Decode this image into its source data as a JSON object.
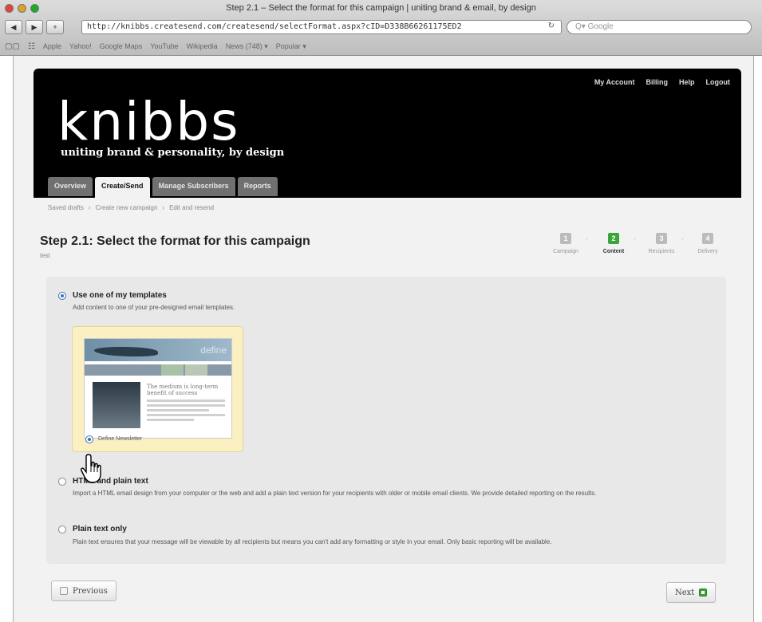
{
  "browser": {
    "window_title": "Step 2.1 – Select the format for this campaign | uniting brand & email, by design",
    "url": "http://knibbs.createsend.com/createsend/selectFormat.aspx?cID=D338B66261175ED2",
    "search_placeholder": "Q▾ Google",
    "bookmarks": [
      "Apple",
      "Yahoo!",
      "Google Maps",
      "YouTube",
      "Wikipedia",
      "News (748) ▾",
      "Popular ▾"
    ]
  },
  "header": {
    "logo": "knibbs",
    "tagline": "uniting brand & personality, by design",
    "account_links": [
      "My Account",
      "Billing",
      "Help",
      "Logout"
    ],
    "tabs": [
      "Overview",
      "Create/Send",
      "Manage Subscribers",
      "Reports"
    ],
    "active_tab_index": 1
  },
  "breadcrumb": [
    "Saved drafts",
    "›",
    "Create new campaign",
    "›",
    "Edit and resend"
  ],
  "step": {
    "title": "Step 2.1: Select the format for this campaign",
    "subtitle": "test",
    "progress": [
      {
        "num": "1",
        "label": "Campaign"
      },
      {
        "num": "2",
        "label": "Content"
      },
      {
        "num": "3",
        "label": "Recipients"
      },
      {
        "num": "4",
        "label": "Delivery"
      }
    ],
    "current_step_index": 1
  },
  "options": {
    "templates": {
      "title": "Use one of my templates",
      "desc": "Add content to one of your pre-designed email templates.",
      "template_label": "Define Newsletter",
      "thumb_word": "define",
      "thumb_heading": "The medium is long-term benefit of success"
    },
    "html": {
      "title": "HTML and plain text",
      "desc": "Import a HTML email design from your computer or the web and add a plain text version for your recipients with older or mobile email clients. We provide detailed reporting on the results."
    },
    "plain": {
      "title": "Plain text only",
      "desc": "Plain text ensures that your message will be viewable by all recipients but means you can't add any formatting or style in your email. Only basic reporting will be available."
    }
  },
  "buttons": {
    "previous": "Previous",
    "next": "Next"
  },
  "colors": {
    "header_bg": "#000000",
    "accent_green": "#3aa53a",
    "template_card_bg": "#fbf0c2"
  }
}
